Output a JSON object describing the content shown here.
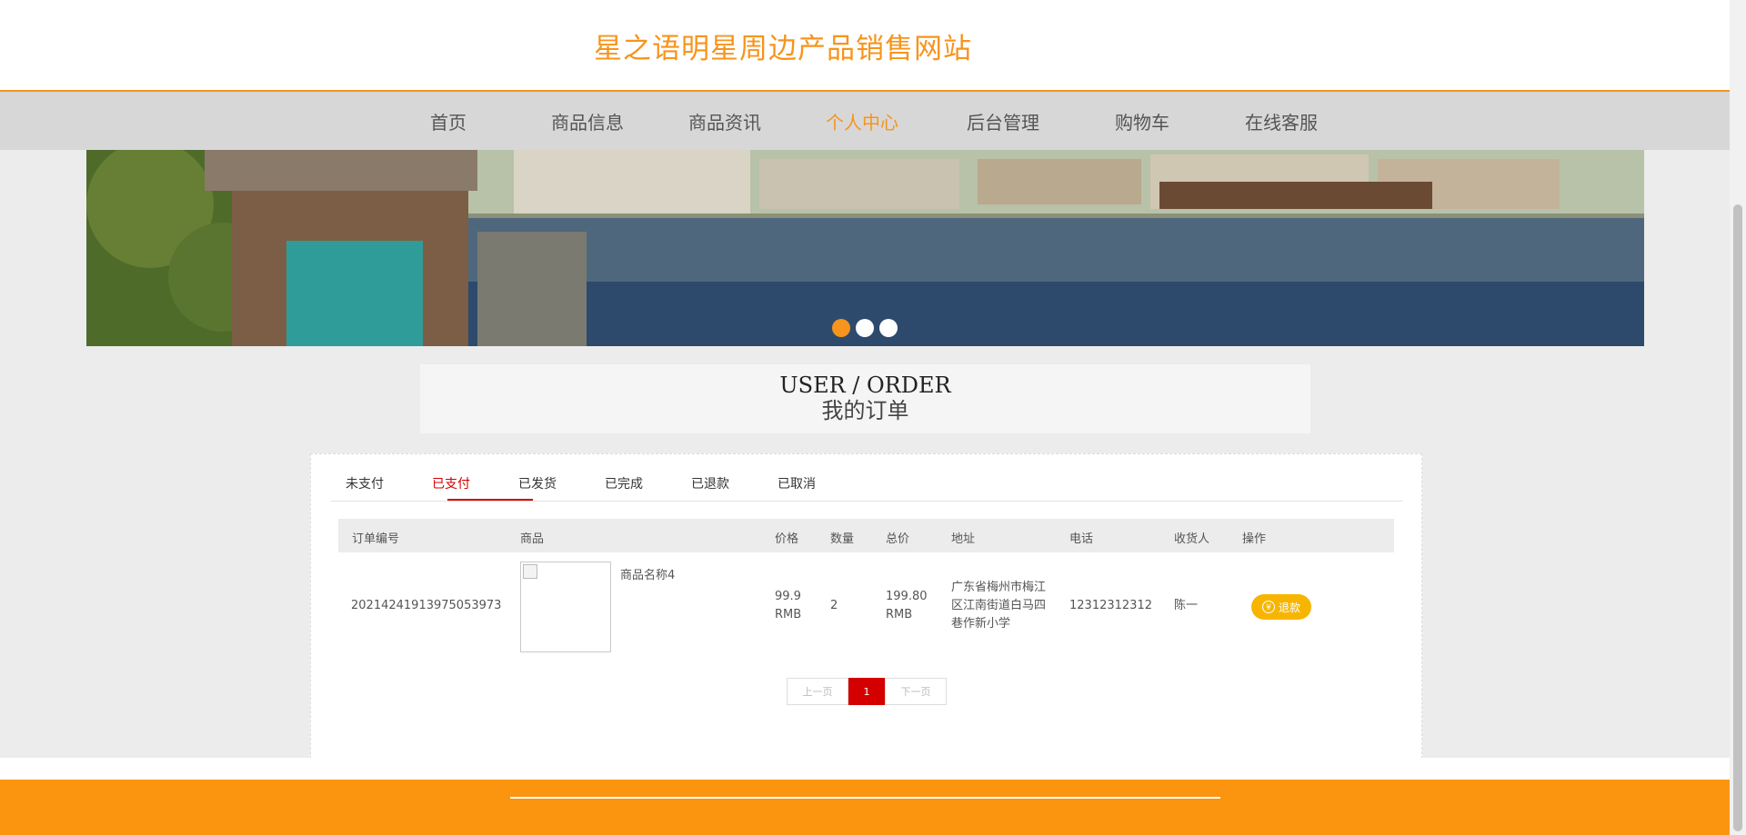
{
  "site": {
    "title": "星之语明星周边产品销售网站"
  },
  "nav": {
    "items": [
      {
        "label": "首页"
      },
      {
        "label": "商品信息"
      },
      {
        "label": "商品资讯"
      },
      {
        "label": "个人中心"
      },
      {
        "label": "后台管理"
      },
      {
        "label": "购物车"
      },
      {
        "label": "在线客服"
      }
    ],
    "active": "个人中心"
  },
  "banner": {
    "slides": 3,
    "active_slide": 1
  },
  "section": {
    "title_en": "USER / ORDER",
    "title_zh": "我的订单"
  },
  "tabs": {
    "items": [
      {
        "label": "未支付"
      },
      {
        "label": "已支付"
      },
      {
        "label": "已发货"
      },
      {
        "label": "已完成"
      },
      {
        "label": "已退款"
      },
      {
        "label": "已取消"
      }
    ],
    "active": "已支付"
  },
  "table": {
    "columns": [
      "订单编号",
      "商品",
      "价格",
      "数量",
      "总价",
      "地址",
      "电话",
      "收货人",
      "操作"
    ],
    "rows": [
      {
        "order_no": "20214241913975053973",
        "product_name": "商品名称4",
        "price": "99.9 RMB",
        "quantity": "2",
        "total": "199.80 RMB",
        "address": "广东省梅州市梅江区江南街道白马四巷作新小学",
        "phone": "12312312312",
        "receiver": "陈一",
        "action_label": "退款"
      }
    ]
  },
  "pagination": {
    "prev_label": "上一页",
    "current": "1",
    "next_label": "下一页"
  },
  "colors": {
    "accent": "#f7941d",
    "active_tab": "#d40000",
    "refund_button": "#f7b500",
    "footer": "#fb9510"
  },
  "icons": {
    "refund": "yen-icon"
  }
}
